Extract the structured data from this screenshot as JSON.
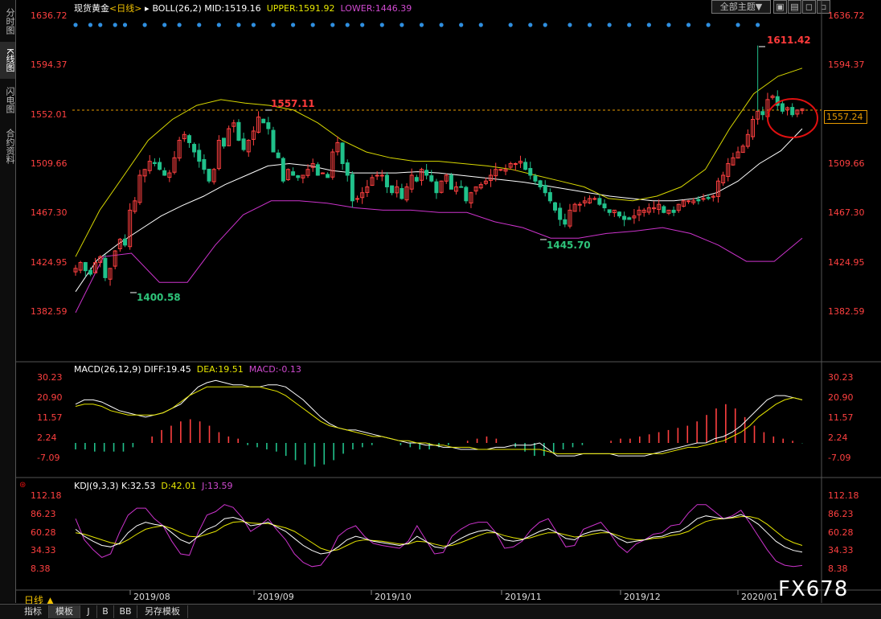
{
  "sidebar": {
    "tabs": [
      "分时图",
      "K线图",
      "闪电图",
      "合约资料"
    ],
    "active": 1
  },
  "toolbar": {
    "sector_label": "全部主题▼",
    "icons": [
      "camera-icon",
      "grid-icon",
      "window-icon"
    ]
  },
  "main_panel": {
    "title_instrument": "现货黄金",
    "title_period": "<日线>",
    "boll_label": "BOLL(26,2)",
    "mid_label": "MID:1519.16",
    "upper_label": "UPPER:1591.92",
    "lower_label": "LOWER:1446.39",
    "y_ticks": [
      "1636.72",
      "1594.37",
      "1552.01",
      "1509.66",
      "1467.30",
      "1424.95",
      "1382.59"
    ],
    "current_price": "1557.24",
    "high_label": "1611.42",
    "low_label": "1400.58",
    "swing_high_label": "1557.11",
    "swing_low_label": "1445.70"
  },
  "macd_panel": {
    "label": "MACD(26,12,9)",
    "diff": "DIFF:19.45",
    "dea": "DEA:19.51",
    "macd": "MACD:-0.13",
    "y_ticks": [
      "30.23",
      "20.90",
      "11.57",
      "2.24",
      "-7.09"
    ]
  },
  "kdj_panel": {
    "label": "KDJ(9,3,3)",
    "k": "K:32.53",
    "d": "D:42.01",
    "j": "J:13.59",
    "y_ticks": [
      "112.18",
      "86.23",
      "60.28",
      "34.33",
      "8.38"
    ]
  },
  "x_axis": {
    "labels": [
      "2019/08",
      "2019/09",
      "2019/10",
      "2019/11",
      "2019/12",
      "2020/01"
    ]
  },
  "bottom_bar": {
    "period_label": "日线 ▲",
    "tabs": [
      "指标",
      "模板",
      "J",
      "B",
      "BB",
      "另存模板"
    ]
  },
  "watermark": "FX678",
  "colors": {
    "up": "#ff4040",
    "down": "#21c18b",
    "mid": "#ffffff",
    "upper": "#d8d800",
    "lower": "#cc33cc",
    "dea_line": "#e6e600",
    "label_red": "#ff3b3b",
    "label_green": "#2ec47a",
    "dot_blue": "#2f8fe0"
  },
  "chart_data": [
    {
      "type": "candlestick",
      "title": "现货黄金 日线 BOLL(26,2)",
      "x_range": [
        "2019/07",
        "2020/01"
      ],
      "ylim": [
        1382.59,
        1636.72
      ],
      "y_ticks": [
        1636.72,
        1594.37,
        1552.01,
        1509.66,
        1467.3,
        1424.95,
        1382.59
      ],
      "series": [
        {
          "name": "Close",
          "values": [
            1420,
            1425,
            1418,
            1415,
            1425,
            1430,
            1412,
            1420,
            1435,
            1445,
            1440,
            1470,
            1478,
            1500,
            1505,
            1512,
            1510,
            1505,
            1500,
            1502,
            1515,
            1530,
            1535,
            1528,
            1520,
            1512,
            1505,
            1495,
            1505,
            1530,
            1525,
            1540,
            1545,
            1530,
            1522,
            1530,
            1538,
            1550,
            1545,
            1540,
            1520,
            1515,
            1495,
            1505,
            1500,
            1498,
            1500,
            1505,
            1510,
            1500,
            1502,
            1498,
            1520,
            1528,
            1510,
            1500,
            1478,
            1480,
            1485,
            1490,
            1498,
            1500,
            1500,
            1490,
            1485,
            1490,
            1480,
            1490,
            1500,
            1495,
            1505,
            1500,
            1495,
            1485,
            1495,
            1500,
            1488,
            1490,
            1490,
            1478,
            1485,
            1490,
            1492,
            1495,
            1500,
            1505,
            1505,
            1505,
            1510,
            1510,
            1512,
            1505,
            1500,
            1495,
            1490,
            1485,
            1478,
            1470,
            1462,
            1458,
            1470,
            1475,
            1475,
            1478,
            1480,
            1480,
            1475,
            1472,
            1468,
            1470,
            1465,
            1462,
            1462,
            1465,
            1470,
            1470,
            1472,
            1472,
            1475,
            1468,
            1470,
            1468,
            1475,
            1478,
            1478,
            1478,
            1478,
            1480,
            1480,
            1482,
            1495,
            1500,
            1510,
            1515,
            1520,
            1525,
            1535,
            1548,
            1555,
            1552,
            1565,
            1568,
            1560,
            1555,
            1558,
            1552,
            1556,
            1557
          ]
        },
        {
          "name": "MID",
          "values": [
            1400,
            1427,
            1441,
            1453,
            1465,
            1474,
            1482,
            1492,
            1500,
            1508,
            1510,
            1508,
            1504,
            1502,
            1502,
            1502,
            1503,
            1502,
            1500,
            1498,
            1496,
            1494,
            1491,
            1488,
            1485,
            1482,
            1480,
            1478,
            1478,
            1480,
            1485,
            1495,
            1510,
            1521,
            1540
          ]
        },
        {
          "name": "UPPER",
          "values": [
            1430,
            1470,
            1500,
            1530,
            1548,
            1560,
            1565,
            1562,
            1560,
            1556,
            1545,
            1530,
            1520,
            1515,
            1512,
            1512,
            1510,
            1508,
            1505,
            1500,
            1495,
            1490,
            1480,
            1478,
            1482,
            1490,
            1505,
            1540,
            1570,
            1585,
            1592
          ]
        },
        {
          "name": "LOWER",
          "values": [
            1382,
            1430,
            1433,
            1408,
            1408,
            1440,
            1466,
            1478,
            1478,
            1476,
            1472,
            1470,
            1470,
            1468,
            1468,
            1460,
            1455,
            1446,
            1446,
            1450,
            1452,
            1455,
            1450,
            1440,
            1426,
            1426,
            1446
          ]
        }
      ],
      "annotations": [
        "1611.42",
        "1557.11",
        "1400.58",
        "1445.70",
        "1557.24"
      ]
    },
    {
      "type": "bar",
      "title": "MACD(26,12,9)",
      "ylim": [
        -7.09,
        30.23
      ],
      "y_ticks": [
        30.23,
        20.9,
        11.57,
        2.24,
        -7.09
      ],
      "series": [
        {
          "name": "DIFF",
          "values": [
            18,
            20,
            20,
            19,
            17,
            15,
            14,
            13,
            12,
            13,
            14,
            16,
            18,
            22,
            26,
            28,
            29,
            28,
            27,
            27,
            26,
            26,
            27,
            27,
            26,
            23,
            20,
            16,
            12,
            9,
            7,
            6,
            6,
            5,
            4,
            3,
            2,
            1,
            0,
            0,
            -1,
            -1,
            -2,
            -2,
            -3,
            -3,
            -3,
            -3,
            -2,
            -2,
            -1,
            -1,
            -1,
            0,
            -3,
            -6,
            -6,
            -6,
            -5,
            -5,
            -5,
            -5,
            -6,
            -6,
            -6,
            -6,
            -5,
            -4,
            -3,
            -2,
            -1,
            0,
            0,
            2,
            3,
            5,
            8,
            12,
            16,
            20,
            22,
            22,
            21,
            20
          ]
        },
        {
          "name": "DEA",
          "values": [
            17,
            18,
            18,
            17,
            15,
            14,
            13,
            13,
            13,
            13,
            14,
            16,
            19,
            22,
            24,
            26,
            26,
            26,
            26,
            26,
            26,
            26,
            25,
            24,
            22,
            19,
            16,
            13,
            10,
            8,
            7,
            6,
            5,
            4,
            3,
            3,
            2,
            1,
            1,
            0,
            0,
            -1,
            -1,
            -2,
            -2,
            -2,
            -3,
            -3,
            -3,
            -3,
            -3,
            -3,
            -3,
            -3,
            -4,
            -5,
            -5,
            -5,
            -5,
            -5,
            -5,
            -5,
            -5,
            -5,
            -5,
            -5,
            -5,
            -5,
            -4,
            -3,
            -2,
            -2,
            -1,
            0,
            1,
            3,
            5,
            8,
            12,
            15,
            18,
            20,
            21,
            20
          ]
        },
        {
          "name": "MACD",
          "values": [
            -3,
            -3,
            -4,
            -4,
            -4,
            -4,
            -2,
            0,
            3,
            6,
            8,
            10,
            11,
            10,
            8,
            5,
            3,
            2,
            -1,
            -2,
            -3,
            -4,
            -6,
            -8,
            -10,
            -11,
            -10,
            -8,
            -5,
            -3,
            -2,
            -1,
            0,
            0,
            -1,
            -2,
            -3,
            -3,
            -2,
            -1,
            0,
            1,
            2,
            3,
            2,
            0,
            -2,
            -4,
            -6,
            -6,
            -5,
            -3,
            -2,
            -1,
            0,
            0,
            1,
            2,
            2,
            3,
            4,
            5,
            6,
            7,
            8,
            10,
            13,
            16,
            18,
            16,
            12,
            8,
            5,
            3,
            2,
            1,
            -0.13
          ]
        }
      ]
    },
    {
      "type": "line",
      "title": "KDJ(9,3,3)",
      "ylim": [
        8.38,
        112.18
      ],
      "y_ticks": [
        112.18,
        86.23,
        60.28,
        34.33,
        8.38
      ],
      "series": [
        {
          "name": "K",
          "values": [
            65,
            55,
            48,
            42,
            40,
            45,
            60,
            70,
            75,
            72,
            70,
            60,
            50,
            45,
            55,
            65,
            70,
            80,
            82,
            78,
            70,
            72,
            75,
            68,
            62,
            52,
            42,
            35,
            30,
            32,
            40,
            50,
            55,
            52,
            48,
            46,
            44,
            42,
            45,
            55,
            48,
            40,
            38,
            45,
            52,
            58,
            62,
            64,
            60,
            50,
            48,
            50,
            56,
            62,
            66,
            60,
            52,
            50,
            58,
            62,
            64,
            60,
            52,
            46,
            48,
            50,
            54,
            55,
            60,
            62,
            70,
            80,
            84,
            82,
            80,
            82,
            86,
            80,
            72,
            60,
            48,
            40,
            35,
            32.53
          ]
        },
        {
          "name": "D",
          "values": [
            60,
            58,
            54,
            50,
            46,
            44,
            50,
            58,
            65,
            68,
            70,
            66,
            60,
            55,
            54,
            58,
            62,
            70,
            75,
            76,
            74,
            73,
            73,
            70,
            67,
            62,
            54,
            46,
            38,
            34,
            36,
            42,
            48,
            50,
            49,
            48,
            46,
            44,
            44,
            48,
            47,
            44,
            41,
            42,
            46,
            51,
            56,
            60,
            60,
            56,
            53,
            51,
            53,
            57,
            60,
            60,
            57,
            54,
            55,
            58,
            60,
            60,
            56,
            52,
            50,
            50,
            52,
            53,
            56,
            58,
            62,
            70,
            76,
            79,
            80,
            81,
            83,
            83,
            80,
            72,
            62,
            52,
            46,
            42.01
          ]
        },
        {
          "name": "J",
          "values": [
            80,
            50,
            36,
            25,
            30,
            60,
            85,
            95,
            95,
            80,
            70,
            48,
            30,
            28,
            60,
            85,
            90,
            100,
            96,
            82,
            62,
            70,
            80,
            64,
            50,
            30,
            18,
            12,
            14,
            30,
            55,
            65,
            70,
            55,
            45,
            42,
            40,
            38,
            48,
            70,
            50,
            30,
            32,
            55,
            65,
            72,
            75,
            75,
            60,
            38,
            40,
            48,
            64,
            75,
            80,
            60,
            40,
            42,
            65,
            70,
            75,
            60,
            42,
            32,
            44,
            50,
            58,
            60,
            70,
            72,
            88,
            100,
            100,
            90,
            80,
            84,
            92,
            74,
            55,
            36,
            20,
            14,
            12,
            13.59
          ]
        }
      ]
    }
  ]
}
